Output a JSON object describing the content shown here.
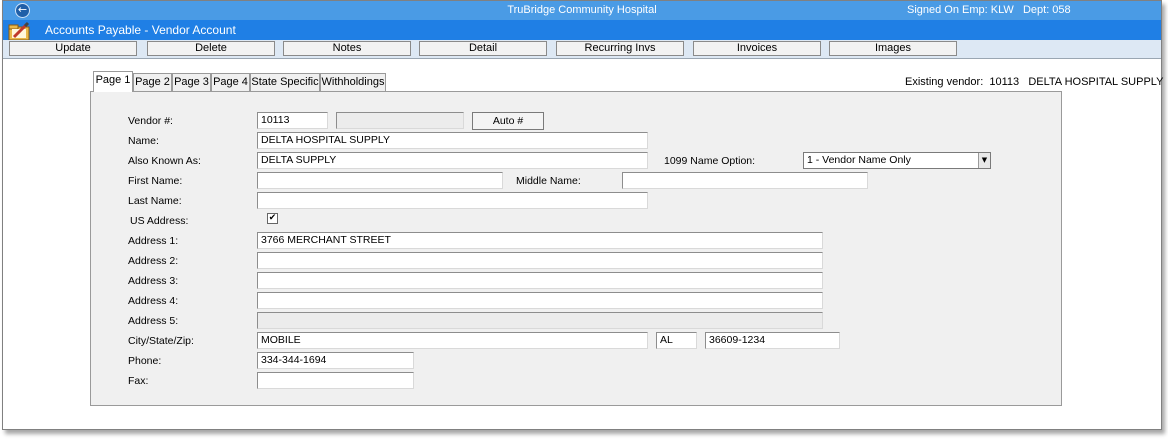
{
  "titlebar": {
    "back_glyph": "←",
    "app_title": "TruBridge Community Hospital",
    "signed_on": "Signed On Emp: KLW   Dept: 058"
  },
  "module": {
    "title": "Accounts Payable - Vendor Account",
    "icon": "folder-pencil-icon"
  },
  "toolbar": {
    "buttons": [
      "Update",
      "Delete",
      "Notes",
      "Detail",
      "Recurring Invs",
      "Invoices",
      "Images"
    ]
  },
  "tabs": [
    "Page 1",
    "Page 2",
    "Page 3",
    "Page 4",
    "State Specific",
    "Withholdings"
  ],
  "active_tab": "Page 1",
  "existing_vendor": "Existing vendor:  10113   DELTA HOSPITAL SUPPLY",
  "form": {
    "vendor_label": "Vendor #:",
    "vendor_number": "10113",
    "vendor_secondary": "",
    "auto_button": "Auto #",
    "name_label": "Name:",
    "name": "DELTA HOSPITAL SUPPLY",
    "aka_label": "Also Known As:",
    "aka": "DELTA SUPPLY",
    "name_option_label": "1099 Name Option:",
    "name_option": "1 - Vendor Name Only",
    "first_name_label": "First Name:",
    "first_name": "",
    "middle_name_label": "Middle Name:",
    "middle_name": "",
    "last_name_label": "Last Name:",
    "last_name": "",
    "us_address_label": "US Address:",
    "us_address_checked": true,
    "check_glyph": "✔",
    "address1_label": "Address 1:",
    "address1": "3766 MERCHANT STREET",
    "address2_label": "Address 2:",
    "address2": "",
    "address3_label": "Address 3:",
    "address3": "",
    "address4_label": "Address 4:",
    "address4": "",
    "address5_label": "Address 5:",
    "address5": "",
    "city_label": "City/State/Zip:",
    "city": "MOBILE",
    "state": "AL",
    "zip": "36609-1234",
    "phone_label": "Phone:",
    "phone": "334-344-1694",
    "fax_label": "Fax:",
    "fax": ""
  },
  "colors": {
    "titlebar": "#4a9be5",
    "module_bar": "#1f7fe5",
    "toolbar": "#dde8f4",
    "panel": "#f0f0f0"
  }
}
